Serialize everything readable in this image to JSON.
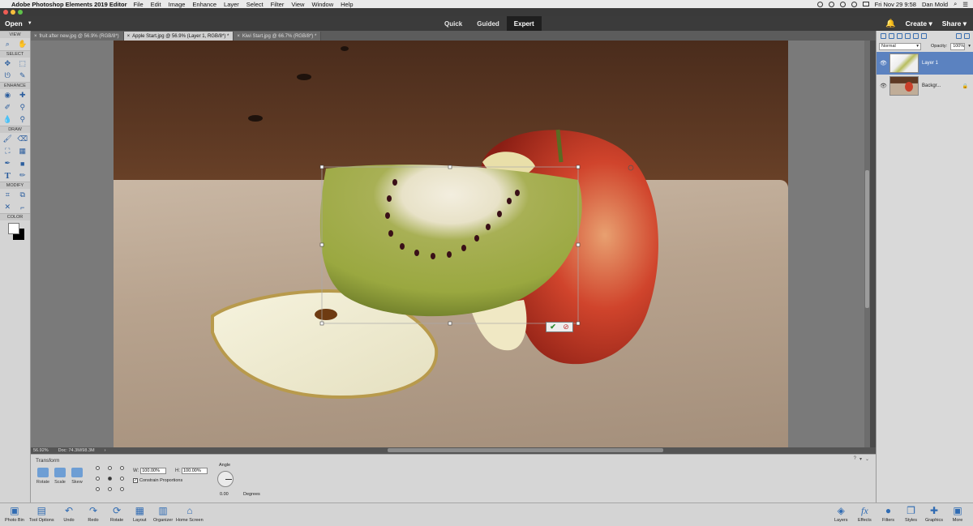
{
  "menubar": {
    "app_name": "Adobe Photoshop Elements 2019 Editor",
    "menus": [
      "File",
      "Edit",
      "Image",
      "Enhance",
      "Layer",
      "Select",
      "Filter",
      "View",
      "Window",
      "Help"
    ],
    "clock": "Fri Nov 29  9:58",
    "user": "Dan Mold"
  },
  "modebar": {
    "open_label": "Open",
    "modes": [
      "Quick",
      "Guided",
      "Expert"
    ],
    "active_mode": "Expert",
    "create_label": "Create",
    "share_label": "Share"
  },
  "doc_tabs": [
    {
      "label": "fruit after new.jpg @ 56.9% (RGB/8*)",
      "active": false
    },
    {
      "label": "Apple Start.jpg @ 56.9% (Layer 1, RGB/8*) *",
      "active": true
    },
    {
      "label": "Kiwi Start.jpg @ 66.7% (RGB/8*) *",
      "active": false
    }
  ],
  "toolbox": {
    "sections": [
      "VIEW",
      "SELECT",
      "ENHANCE",
      "DRAW",
      "MODIFY",
      "COLOR"
    ]
  },
  "status": {
    "zoom": "56.92%",
    "doc": "Doc: 74.3M/98.3M"
  },
  "tool_options": {
    "title": "Transform",
    "buttons": [
      "Rotate",
      "Scale",
      "Skew"
    ],
    "width_label": "W:",
    "width_value": "100.00%",
    "height_label": "H:",
    "height_value": "100.00%",
    "constrain_label": "Constrain Proportions",
    "constrain_checked": true,
    "angle_label": "Angle",
    "angle_value": "0.00",
    "degrees_label": "Degrees"
  },
  "layers_panel": {
    "blend_mode": "Normal",
    "opacity_label": "Opacity:",
    "opacity_value": "100%",
    "layers": [
      {
        "name": "Layer 1",
        "active": true
      },
      {
        "name": "Backgr...",
        "active": false
      }
    ]
  },
  "taskbar": {
    "left": [
      "Photo Bin",
      "Tool Options",
      "Undo",
      "Redo",
      "Rotate",
      "Layout",
      "Organizer",
      "Home Screen"
    ],
    "right": [
      "Layers",
      "Effects",
      "Filters",
      "Styles",
      "Graphics",
      "More"
    ]
  },
  "colors": {
    "accent": "#5b82c0",
    "commit": "#2e8b2e",
    "cancel": "#c03030"
  }
}
